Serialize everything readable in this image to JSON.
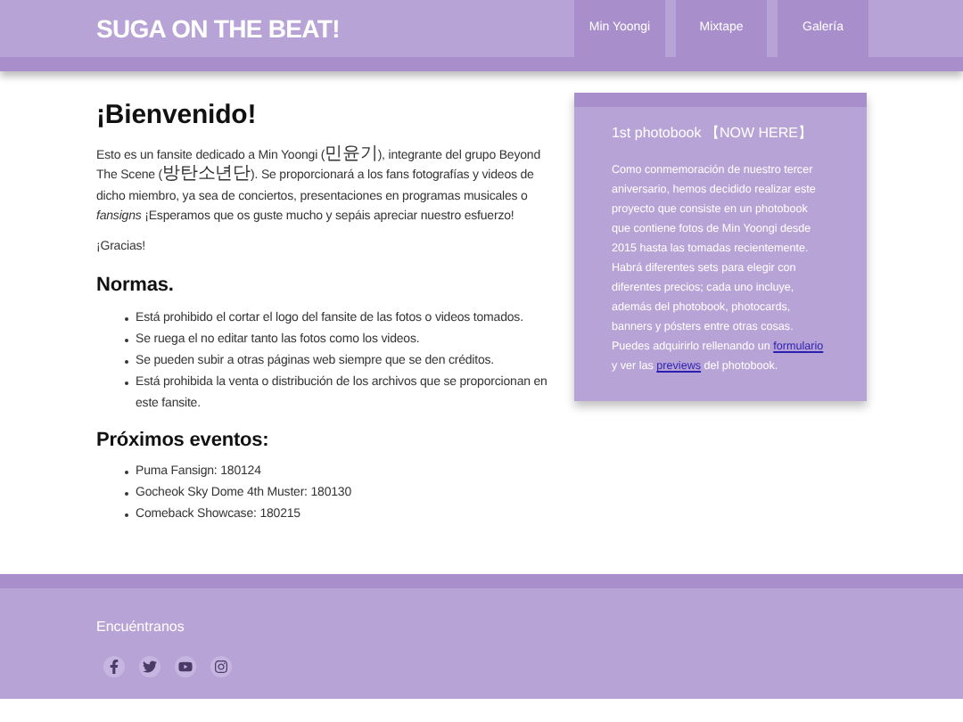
{
  "header": {
    "title": "SUGA ON THE BEAT!",
    "nav": [
      {
        "label": "Min Yoongi"
      },
      {
        "label": "Mixtape"
      },
      {
        "label": "Galería"
      }
    ]
  },
  "main": {
    "heading": "¡Bienvenido!",
    "intro_parts": [
      {
        "kind": "latin",
        "text": "Esto es un fansite dedicado a Min Yoongi ("
      },
      {
        "kind": "cjk",
        "text": "민윤기"
      },
      {
        "kind": "latin",
        "text": "), integrante del grupo Beyond The Scene ("
      },
      {
        "kind": "cjk",
        "text": "방탄소년단"
      },
      {
        "kind": "latin",
        "text": "). Se proporcionará a los fans fotografías y videos de dicho miembro, ya sea de conciertos, presentaciones en programas musicales o *fansigns* ¡Esperamos que os guste mucho y sepáis apreciar nuestro esfuerzo!"
      }
    ],
    "thanks": "¡Gracias!",
    "rules_heading": "Normas.",
    "rules": [
      "Está prohibido el cortar el logo del fansite de las fotos o videos tomados.",
      "Se ruega el no editar tanto las fotos como los videos.",
      "Se pueden subir a otras páginas web siempre que se den créditos.",
      "Está prohibida la venta o distribución de los archivos que se proporcionan en este fansite."
    ],
    "events_heading": "Próximos eventos:",
    "events": [
      "Puma Fansign: 180124",
      "Gocheok Sky Dome 4th Muster: 180130",
      "Comeback Showcase: 180215"
    ]
  },
  "card": {
    "title": "1st photobook 【NOW HERE】",
    "body": [
      {
        "kind": "text",
        "text": "Como conmemoración de nuestro tercer aniversario, hemos decidido realizar este proyecto que consiste en un photobook que contiene fotos de Min Yoongi desde 2015 hasta las tomadas recientemente. Habrá diferentes sets para elegir con diferentes precios; cada uno incluye, además del photobook, photocards, banners y pósters entre otras cosas. Puedes adquirirlo rellenando un "
      },
      {
        "kind": "link",
        "text": "formulario"
      },
      {
        "kind": "text",
        "text": " y ver las "
      },
      {
        "kind": "link",
        "text": "previews"
      },
      {
        "kind": "text",
        "text": " del photobook."
      }
    ]
  },
  "footer": {
    "heading": "Encuéntranos",
    "social": [
      {
        "kind": "facebook"
      },
      {
        "kind": "twitter"
      },
      {
        "kind": "youtube"
      },
      {
        "kind": "instagram"
      }
    ]
  }
}
